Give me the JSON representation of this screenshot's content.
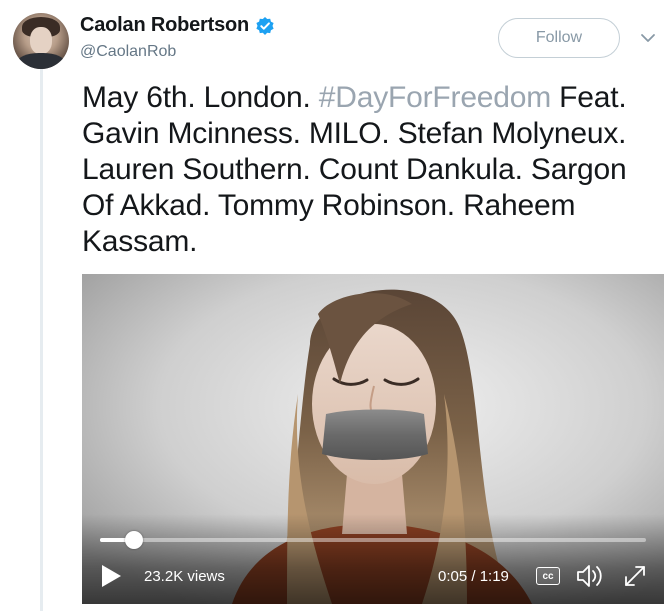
{
  "author": {
    "display_name": "Caolan Robertson",
    "handle": "@CaolanRob",
    "verified": true,
    "avatar_icon": "user-avatar-photo"
  },
  "follow_button": {
    "label": "Follow"
  },
  "menu_icon": "chevron-down-icon",
  "tweet": {
    "text_before_hashtag": "May 6th. London. ",
    "hashtag": "#DayForFreedom",
    "text_after_hashtag": " Feat. Gavin Mcinness. MILO. Stefan Molyneux. Lauren Southern. Count Dankula. Sargon Of Akkad. Tommy Robinson. Raheem Kassam."
  },
  "video": {
    "views": "23.2K views",
    "time": "0:05 / 1:19",
    "cc_label": "cc",
    "progress_fraction": 0.063
  },
  "colors": {
    "hashtag": "#9aa5b0",
    "verified_badge": "#1da1f2",
    "follow_text": "#8899a6"
  }
}
